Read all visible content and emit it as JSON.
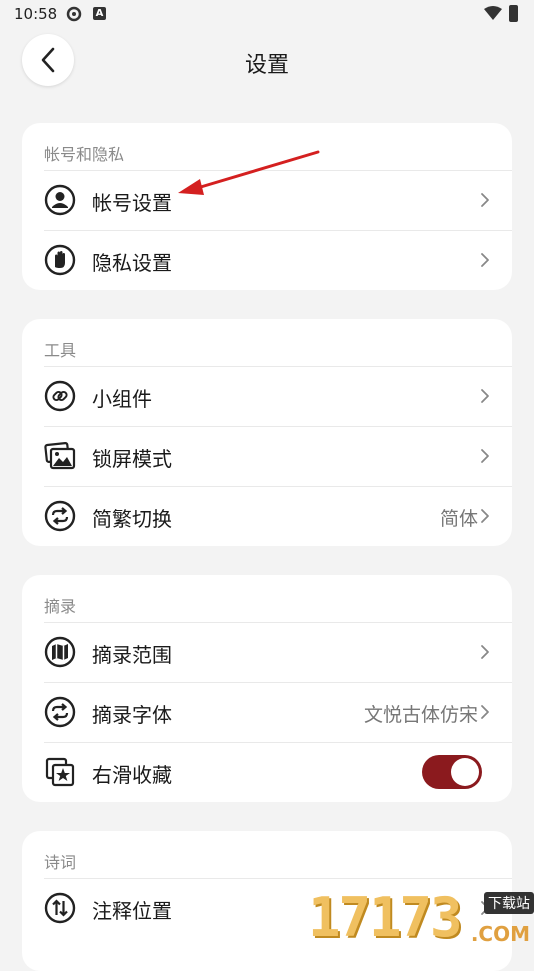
{
  "status_bar": {
    "time": "10:58",
    "icon_a": "A"
  },
  "header": {
    "title": "设置"
  },
  "sections": [
    {
      "title": "帐号和隐私",
      "rows": [
        {
          "label": "帐号设置",
          "value": "",
          "icon": "account-icon",
          "control": "chevron"
        },
        {
          "label": "隐私设置",
          "value": "",
          "icon": "hand-icon",
          "control": "chevron"
        }
      ]
    },
    {
      "title": "工具",
      "rows": [
        {
          "label": "小组件",
          "value": "",
          "icon": "link-icon",
          "control": "chevron"
        },
        {
          "label": "锁屏模式",
          "value": "",
          "icon": "image-icon",
          "control": "chevron"
        },
        {
          "label": "简繁切换",
          "value": "简体",
          "icon": "swap-icon",
          "control": "chevron"
        }
      ]
    },
    {
      "title": "摘录",
      "rows": [
        {
          "label": "摘录范围",
          "value": "",
          "icon": "map-icon",
          "control": "chevron"
        },
        {
          "label": "摘录字体",
          "value": "文悦古体仿宋",
          "icon": "swap-icon",
          "control": "chevron"
        },
        {
          "label": "右滑收藏",
          "value": "",
          "icon": "star-collection-icon",
          "control": "toggle",
          "toggle_on": true
        }
      ]
    },
    {
      "title": "诗词",
      "rows": [
        {
          "label": "注释位置",
          "value": "",
          "icon": "updown-icon",
          "control": "chevron"
        }
      ]
    }
  ],
  "watermark": {
    "digits": "17173",
    "badge": "下载站",
    "suffix": ".COM"
  },
  "colors": {
    "accent": "#8b1a1e",
    "background": "#f3f3f3",
    "card": "#ffffff",
    "arrow": "#d42020"
  }
}
